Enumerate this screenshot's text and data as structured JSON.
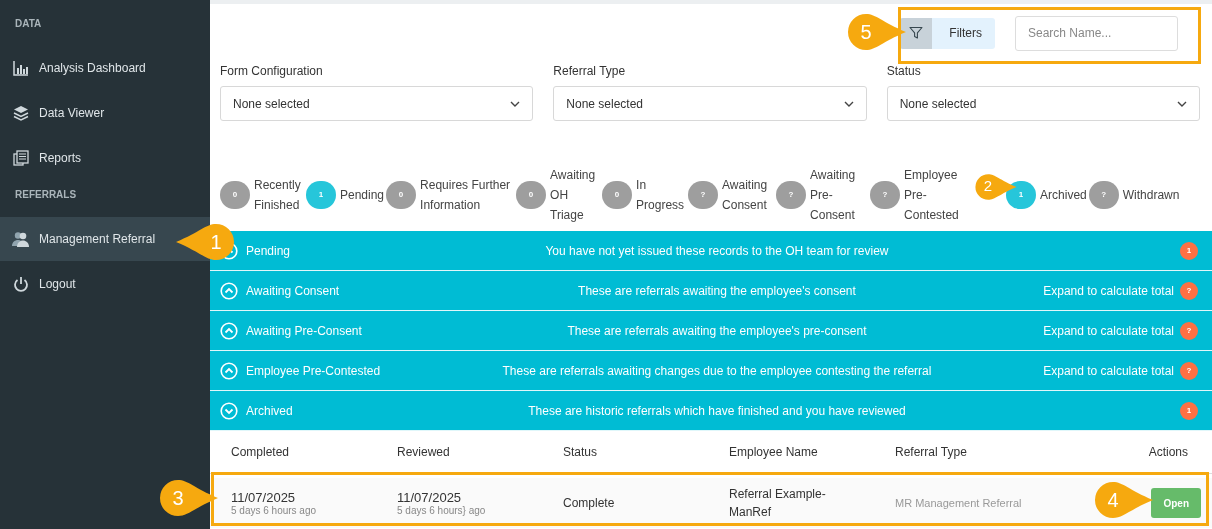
{
  "sidebar": {
    "sections": [
      {
        "heading": "DATA",
        "items": [
          {
            "label": "Analysis Dashboard",
            "selected": false
          },
          {
            "label": "Data Viewer",
            "selected": false
          },
          {
            "label": "Reports",
            "selected": false
          }
        ]
      },
      {
        "heading": "REFERRALS",
        "items": [
          {
            "label": "Management Referral",
            "selected": true
          },
          {
            "label": "Logout",
            "selected": false
          }
        ]
      }
    ]
  },
  "toolbar": {
    "filters_button": "Filters",
    "search": {
      "placeholder": "Search Name..."
    }
  },
  "dropdowns": [
    {
      "label": "Form Configuration",
      "value": "None selected"
    },
    {
      "label": "Referral Type",
      "value": "None selected"
    },
    {
      "label": "Status",
      "value": "None selected"
    }
  ],
  "status_chips": [
    {
      "count": "0",
      "label": "Recently Finished",
      "color": "#9e9e9e"
    },
    {
      "count": "1",
      "label": "Pending",
      "color": "#26c6da"
    },
    {
      "count": "0",
      "label": "Requires Further Information",
      "color": "#9e9e9e"
    },
    {
      "count": "0",
      "label": "Awaiting OH Triage",
      "color": "#9e9e9e"
    },
    {
      "count": "0",
      "label": "In Progress",
      "color": "#9e9e9e"
    },
    {
      "count": "?",
      "label": "Awaiting Consent",
      "color": "#9e9e9e"
    },
    {
      "count": "?",
      "label": "Awaiting Pre-Consent",
      "color": "#9e9e9e"
    },
    {
      "count": "?",
      "label": "Employee Pre-Contested",
      "color": "#9e9e9e"
    },
    {
      "count": "1",
      "label": "Archived",
      "color": "#26c6da"
    },
    {
      "count": "?",
      "label": "Withdrawn",
      "color": "#9e9e9e"
    }
  ],
  "sections": [
    {
      "title": "Pending",
      "description": "You have not yet issued these records to the OH team for review",
      "expanded": false,
      "badge": "1"
    },
    {
      "title": "Awaiting Consent",
      "description": "These are referrals awaiting the employee's consent",
      "expanded": false,
      "total_hint": "Expand to calculate total",
      "badge": "?"
    },
    {
      "title": "Awaiting Pre-Consent",
      "description": "These are referrals awaiting the employee's pre-consent",
      "expanded": false,
      "total_hint": "Expand to calculate total",
      "badge": "?"
    },
    {
      "title": "Employee Pre-Contested",
      "description": "These are referrals awaiting changes due to the employee contesting the referral",
      "expanded": false,
      "total_hint": "Expand to calculate total",
      "badge": "?"
    },
    {
      "title": "Archived",
      "description": "These are historic referrals which have finished and you have reviewed",
      "expanded": true,
      "badge": "1"
    }
  ],
  "table": {
    "columns": [
      "Completed",
      "Reviewed",
      "Status",
      "Employee Name",
      "Referral Type",
      "Actions"
    ],
    "rows": [
      {
        "completed": "11/07/2025",
        "completed_ago": "5 days 6 hours ago",
        "reviewed": "11/07/2025",
        "reviewed_ago": "5 days 6 hours} ago",
        "status": "Complete",
        "employee": "Referral Example-ManRef",
        "referral_type": "MR Management Referral",
        "action": "Open"
      }
    ]
  },
  "callouts": [
    "1",
    "2",
    "3",
    "4",
    "5"
  ]
}
